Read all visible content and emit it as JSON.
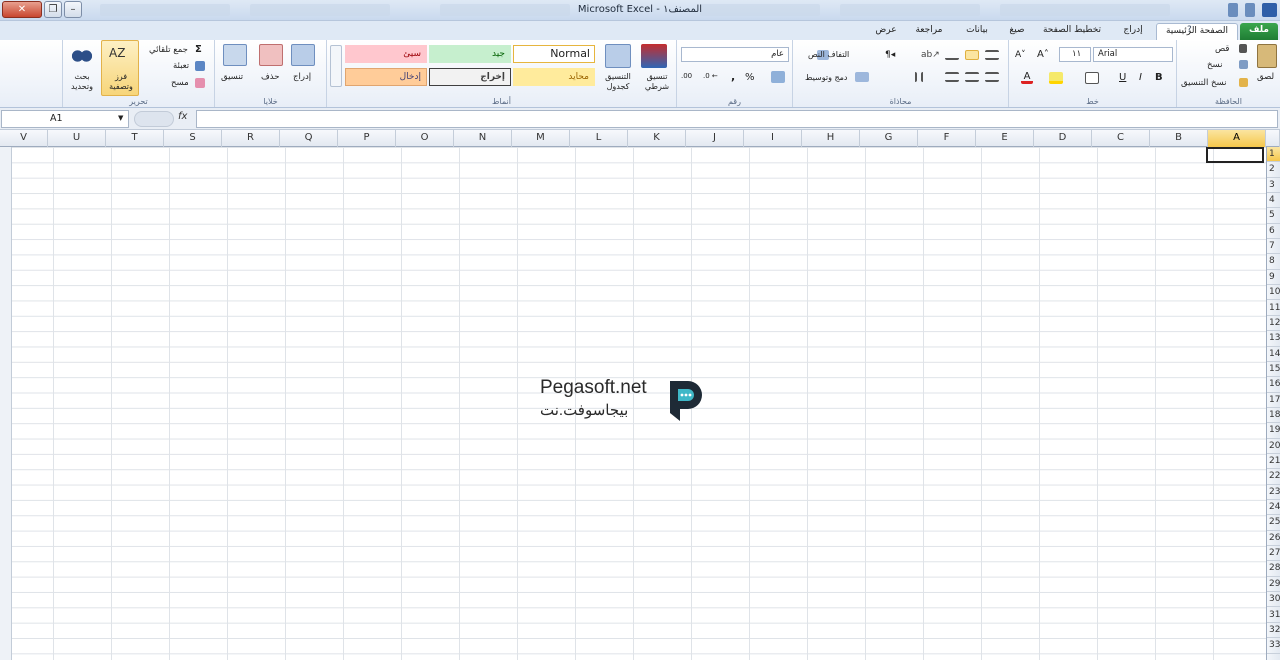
{
  "window": {
    "title": "Microsoft Excel - المصنف١"
  },
  "tabs": [
    {
      "label": "ملف",
      "id": "file"
    },
    {
      "label": "الصفحة الرئيسية",
      "id": "home"
    },
    {
      "label": "إدراج",
      "id": "insert"
    },
    {
      "label": "تخطيط الصفحة",
      "id": "layout"
    },
    {
      "label": "صيغ",
      "id": "formulas"
    },
    {
      "label": "بيانات",
      "id": "data"
    },
    {
      "label": "مراجعة",
      "id": "review"
    },
    {
      "label": "عرض",
      "id": "view"
    }
  ],
  "ribbon": {
    "clipboard": {
      "paste": "لصق",
      "cut": "قص",
      "copy": "نسخ",
      "format_painter": "نسخ التنسيق",
      "label": "الحافظة"
    },
    "font": {
      "name": "Arial",
      "size": "١١",
      "label": "خط",
      "bold": "B",
      "italic": "I",
      "underline": "U"
    },
    "alignment": {
      "wrap": "التفاف النص",
      "merge": "دمج وتوسيط",
      "label": "محاذاة"
    },
    "number": {
      "format": "عام",
      "percent": "%",
      "comma": ",",
      "label": "رقم"
    },
    "styles": {
      "conditional": "تنسيق شرطي",
      "as_table": "التنسيق كجدول",
      "cells": [
        "Normal",
        "جيد",
        "سيئ",
        "محايد",
        "إخراج",
        "إدخال"
      ],
      "label": "أنماط"
    },
    "cells": {
      "insert": "إدراج",
      "delete": "حذف",
      "format": "تنسيق",
      "label": "خلايا"
    },
    "editing": {
      "autosum": "جمع تلقائي",
      "fill": "تعبئة",
      "clear": "مسح",
      "sort": "فرز وتصفية",
      "find": "بحث وتحديد",
      "label": "تحرير"
    }
  },
  "formula_bar": {
    "name_box": "A1",
    "fx": "fx",
    "value": ""
  },
  "columns": [
    "A",
    "B",
    "C",
    "D",
    "E",
    "F",
    "G",
    "H",
    "I",
    "J",
    "K",
    "L",
    "M",
    "N",
    "O",
    "P",
    "Q",
    "R",
    "S",
    "T",
    "U",
    "V"
  ],
  "rows": [
    "1",
    "2",
    "3",
    "4",
    "5",
    "6",
    "7",
    "8",
    "9",
    "10",
    "11",
    "12",
    "13",
    "14",
    "15",
    "16",
    "17",
    "18",
    "19",
    "20",
    "21",
    "22",
    "23",
    "24",
    "25",
    "26",
    "27",
    "28",
    "29",
    "30",
    "31",
    "32",
    "33"
  ],
  "selected_cell": "A1",
  "watermark": {
    "en": "Pegasoft.net",
    "ar": "بيجاسوفت.نت"
  },
  "colors": {
    "accent": "#1f7d34",
    "selection": "#f5c74c"
  }
}
